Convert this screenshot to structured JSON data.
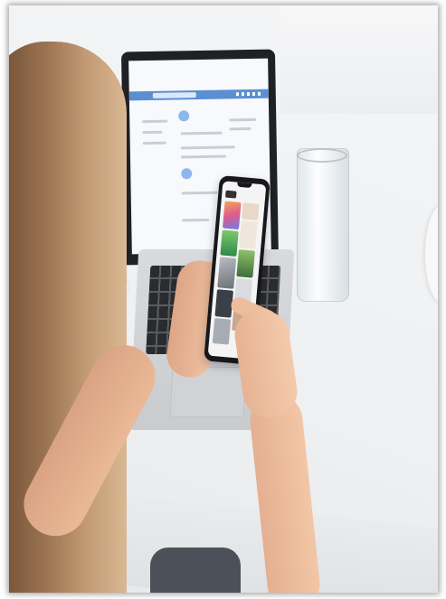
{
  "scene": {
    "subject": "",
    "colors": {
      "desk": "#eef0f2",
      "laptop_body": "#d8dadd",
      "laptop_lid": "#1f2124",
      "screen_header": "#5b8fd1",
      "phone_body": "#16181b",
      "hair": "#9a7352",
      "skin": "#eab996"
    }
  }
}
